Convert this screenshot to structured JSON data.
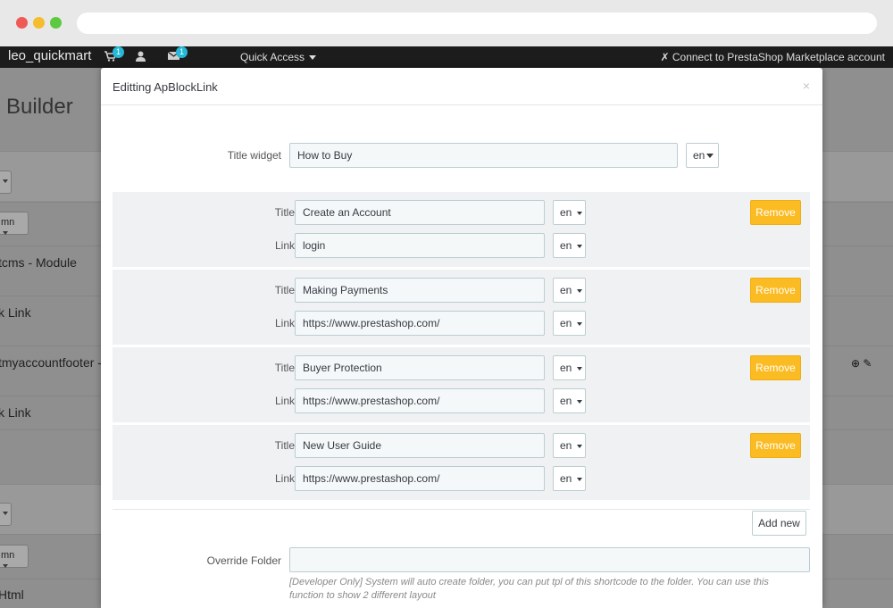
{
  "topbar": {
    "shop_name": "leo_quickmart",
    "cart_badge": "1",
    "mail_badge": "1",
    "quick_access": "Quick Access",
    "connect": "Connect to PrestaShop Marketplace account"
  },
  "background": {
    "title": "Builder",
    "rows": [
      {
        "text": "tcms - Module"
      },
      {
        "text": "k Link"
      },
      {
        "text": "tmyaccountfooter -"
      },
      {
        "text": "k Link"
      },
      {
        "text": "Html"
      }
    ],
    "column_btn": "mn"
  },
  "modal": {
    "title": "Editting ApBlockLink",
    "close": "×",
    "title_widget_label": "Title widget",
    "title_widget_value": "How to Buy",
    "lang": "en",
    "title_label": "Title",
    "link_label": "Link",
    "remove_label": "Remove",
    "groups": [
      {
        "title": "Create an Account",
        "link": "login"
      },
      {
        "title": "Making Payments",
        "link": "https://www.prestashop.com/"
      },
      {
        "title": "Buyer Protection",
        "link": "https://www.prestashop.com/"
      },
      {
        "title": "New User Guide",
        "link": "https://www.prestashop.com/"
      }
    ],
    "add_new": "Add new",
    "override_folder_label": "Override Folder",
    "override_folder_value": "",
    "help_text": "[Developer Only] System will auto create folder, you can put tpl of this shortcode to the folder. You can use this function to show 2 different layout"
  },
  "colors": {
    "remove_button": "#fbbb22",
    "badge": "#25b9d7",
    "topbar": "#1c1c1c"
  }
}
